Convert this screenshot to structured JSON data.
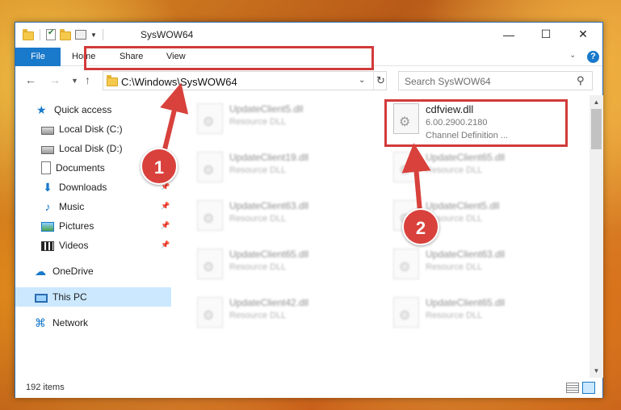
{
  "window": {
    "title": "SysWOW64"
  },
  "ribbon": {
    "tabs": [
      "File",
      "Home",
      "Share",
      "View"
    ]
  },
  "address": {
    "path": "C:\\Windows\\SysWOW64"
  },
  "search": {
    "placeholder": "Search SysWOW64"
  },
  "sidebar": {
    "items": [
      {
        "label": "Quick access",
        "icon": "star-icon"
      },
      {
        "label": "Local Disk (C:)",
        "icon": "disk-icon"
      },
      {
        "label": "Local Disk (D:)",
        "icon": "disk-icon"
      },
      {
        "label": "Documents",
        "icon": "document-icon"
      },
      {
        "label": "Downloads",
        "icon": "download-icon",
        "pinned": true
      },
      {
        "label": "Music",
        "icon": "music-icon",
        "pinned": true
      },
      {
        "label": "Pictures",
        "icon": "pictures-icon",
        "pinned": true
      },
      {
        "label": "Videos",
        "icon": "videos-icon",
        "pinned": true
      },
      {
        "label": "OneDrive",
        "icon": "cloud-icon"
      },
      {
        "label": "This PC",
        "icon": "computer-icon",
        "selected": true
      },
      {
        "label": "Network",
        "icon": "network-icon"
      }
    ]
  },
  "files": {
    "highlighted": {
      "name": "cdfview.dll",
      "version": "6.00.2900.2180",
      "description": "Channel Definition ..."
    },
    "left_column": [
      {
        "name": "UpdateClient5.dll",
        "type": "Resource DLL"
      },
      {
        "name": "UpdateClient19.dll",
        "type": "Resource DLL"
      },
      {
        "name": "UpdateClient63.dll",
        "type": "Resource DLL"
      },
      {
        "name": "UpdateClient65.dll",
        "type": "Resource DLL"
      },
      {
        "name": "UpdateClient42.dll",
        "type": "Resource DLL"
      }
    ],
    "right_column": [
      {
        "name": "UpdateClient65.dll",
        "type": "Resource DLL"
      },
      {
        "name": "UpdateClient5.dll",
        "type": "Resource DLL"
      },
      {
        "name": "UpdateClient63.dll",
        "type": "Resource DLL"
      },
      {
        "name": "UpdateClient65.dll",
        "type": "Resource DLL"
      }
    ]
  },
  "status": {
    "item_count": "192 items"
  },
  "callouts": {
    "one": "1",
    "two": "2"
  },
  "colors": {
    "accent": "#1979ca",
    "callout": "#d9413c",
    "highlight_border": "#d23a3a"
  }
}
